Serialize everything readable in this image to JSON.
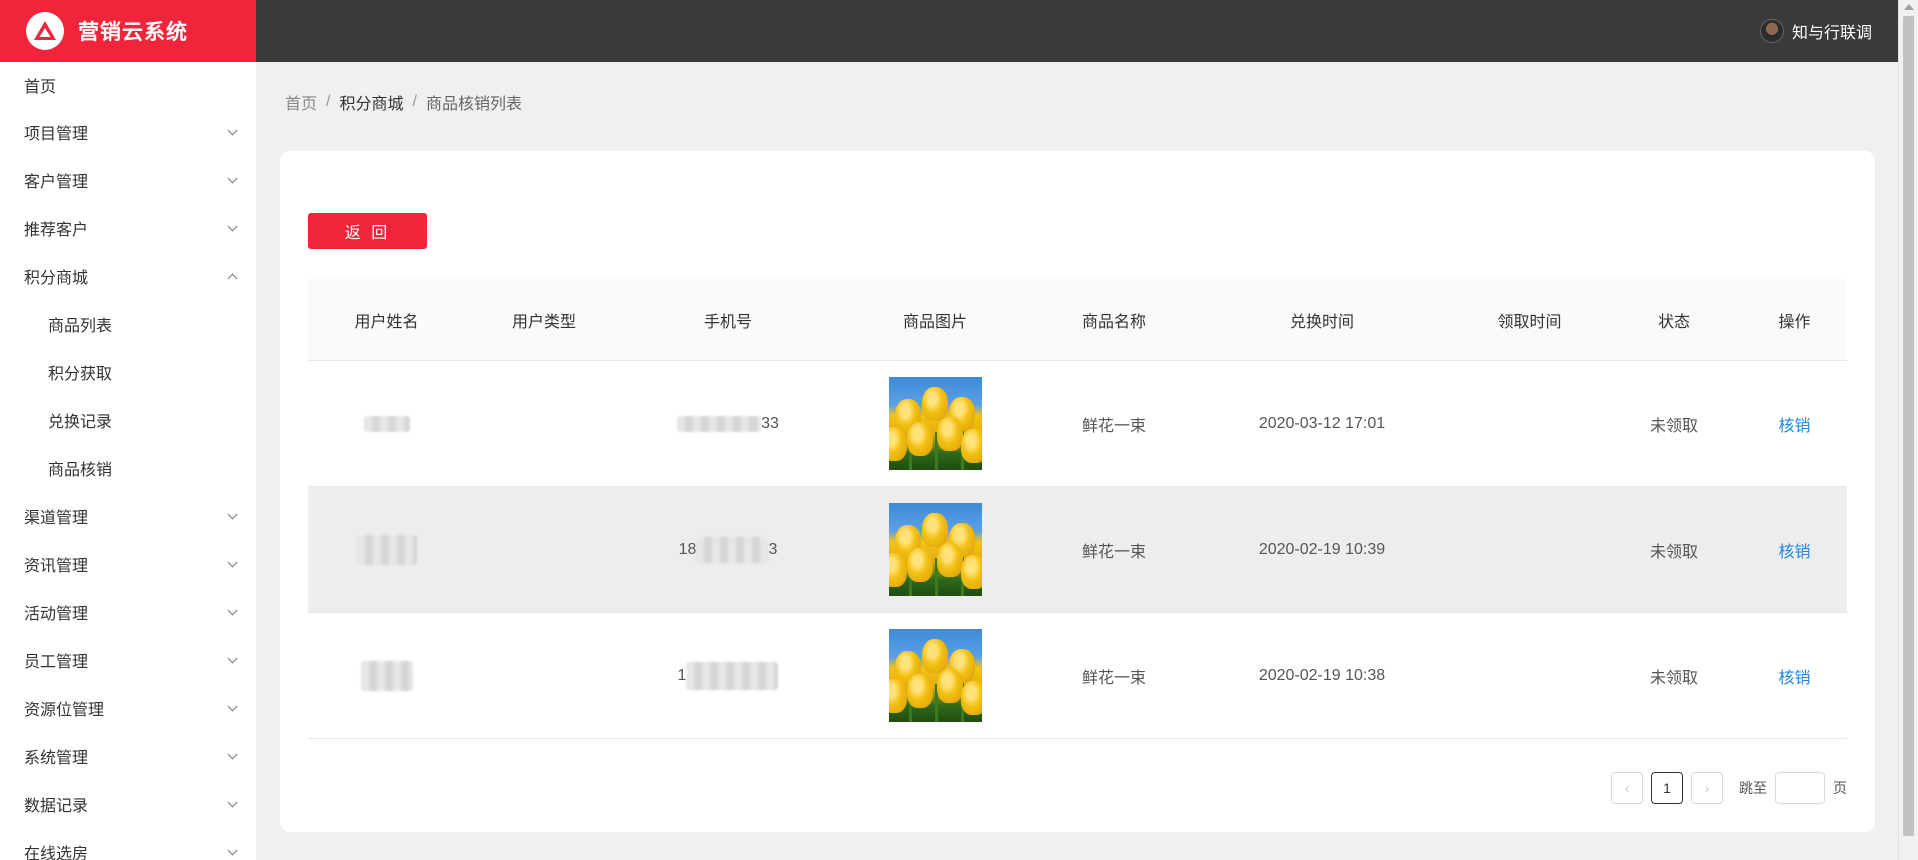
{
  "app": {
    "title": "营销云系统",
    "user_name": "知与行联调"
  },
  "sidebar": {
    "items": [
      {
        "label": "首页"
      },
      {
        "label": "项目管理"
      },
      {
        "label": "客户管理"
      },
      {
        "label": "推荐客户"
      },
      {
        "label": "积分商城",
        "expanded": true,
        "children": [
          "商品列表",
          "积分获取",
          "兑换记录",
          "商品核销"
        ]
      },
      {
        "label": "渠道管理"
      },
      {
        "label": "资讯管理"
      },
      {
        "label": "活动管理"
      },
      {
        "label": "员工管理"
      },
      {
        "label": "资源位管理"
      },
      {
        "label": "系统管理"
      },
      {
        "label": "数据记录"
      },
      {
        "label": "在线选房"
      }
    ]
  },
  "breadcrumb": {
    "home": "首页",
    "section": "积分商城",
    "current": "商品核销列表",
    "separator": "/"
  },
  "toolbar": {
    "back_label": "返 回"
  },
  "table": {
    "headers": [
      "用户姓名",
      "用户类型",
      "手机号",
      "商品图片",
      "商品名称",
      "兑换时间",
      "领取时间",
      "状态",
      "操作"
    ],
    "rows": [
      {
        "phone_prefix": "",
        "phone_suffix": "33",
        "product": "鲜花一束",
        "exchange_time": "2020-03-12 17:01",
        "status": "未领取",
        "action": "核销"
      },
      {
        "phone_prefix": "18",
        "phone_suffix": "3",
        "product": "鲜花一束",
        "exchange_time": "2020-02-19 10:39",
        "status": "未领取",
        "action": "核销"
      },
      {
        "phone_prefix": "1",
        "phone_suffix": "",
        "product": "鲜花一束",
        "exchange_time": "2020-02-19 10:38",
        "status": "未领取",
        "action": "核销"
      }
    ]
  },
  "pagination": {
    "current_page": "1",
    "jump_label": "跳至",
    "page_label": "页",
    "prev": "‹",
    "next": "›"
  },
  "colors": {
    "brand": "#f0253c",
    "topbar": "#3a3a3a",
    "link": "#1e88e5"
  }
}
